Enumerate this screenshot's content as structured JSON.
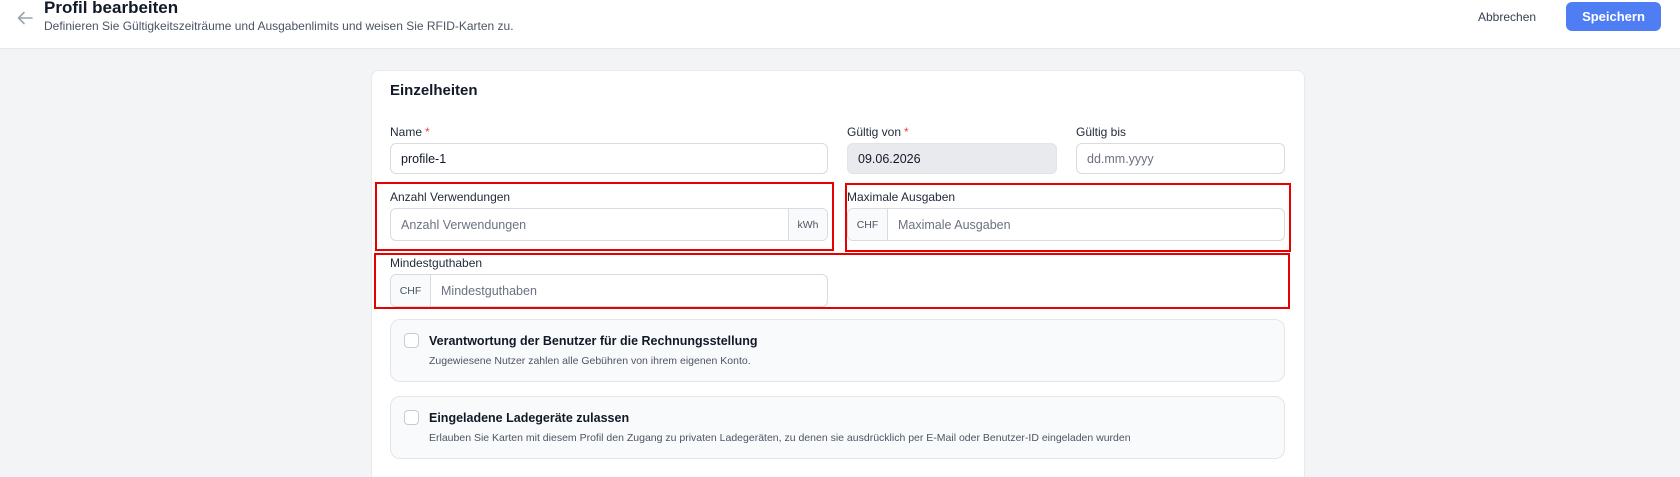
{
  "header": {
    "title": "Profil bearbeiten",
    "subtitle": "Definieren Sie Gültigkeitszeiträume und Ausgabenlimits und weisen Sie RFID-Karten zu.",
    "cancel_label": "Abbrechen",
    "save_label": "Speichern",
    "back_icon": "arrow-left-icon",
    "accent_color": "#4f7df3"
  },
  "details": {
    "section_title": "Einzelheiten",
    "name": {
      "label": "Name",
      "required_mark": "*",
      "value": "profile-1"
    },
    "valid_from": {
      "label": "Gültig von",
      "required_mark": "*",
      "value": "09.06.2026"
    },
    "valid_to": {
      "label": "Gültig bis",
      "placeholder": "dd.mm.yyyy"
    },
    "usage_count": {
      "label": "Anzahl Verwendungen",
      "placeholder": "Anzahl Verwendungen",
      "unit": "kWh"
    },
    "max_spend": {
      "label": "Maximale Ausgaben",
      "placeholder": "Maximale Ausgaben",
      "currency": "CHF"
    },
    "min_balance": {
      "label": "Mindestguthaben",
      "placeholder": "Mindestguthaben",
      "currency": "CHF"
    }
  },
  "options": [
    {
      "title": "Verantwortung der Benutzer für die Rechnungsstellung",
      "description": "Zugewiesene Nutzer zahlen alle Gebühren von ihrem eigenen Konto.",
      "checked": false
    },
    {
      "title": "Eingeladene Ladegeräte zulassen",
      "description": "Erlauben Sie Karten mit diesem Profil den Zugang zu privaten Ladegeräten, zu denen sie ausdrücklich per E-Mail oder Benutzer-ID eingeladen wurden",
      "checked": false
    }
  ],
  "annotation_color": "#e60000"
}
